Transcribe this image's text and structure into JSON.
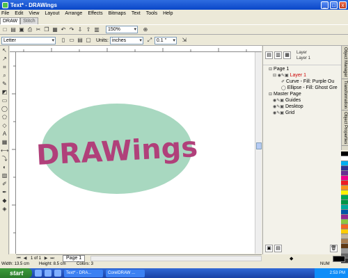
{
  "window": {
    "title": "Text* - DRAWings",
    "controls": [
      "_",
      "□",
      "x"
    ]
  },
  "menu": [
    "File",
    "Edit",
    "View",
    "Layout",
    "Arrange",
    "Effects",
    "Bitmaps",
    "Text",
    "Tools",
    "Help"
  ],
  "mdi_tabs": [
    "DRAW",
    "Stitch"
  ],
  "standard_toolbar": {
    "zoom_value": "150%"
  },
  "property_bar": {
    "paper_size": "Letter",
    "units_label": "Units:",
    "units_value": "inches",
    "nudge_value": "0.1 \""
  },
  "canvas": {
    "ellipse_fill": "#a8d8c0",
    "text": "DRAWings",
    "text_color": "#b0407a"
  },
  "page_nav": {
    "page_tab": "Page 1",
    "page_count": "1 of 1"
  },
  "docker": {
    "header_top": "Layer",
    "header_bottom": "Layer 1",
    "tree": [
      {
        "label": "Page 1",
        "color": "#000"
      },
      {
        "label": "Layer 1",
        "color": "#c00"
      },
      {
        "label": "Curve - Fill: Purple  Ou",
        "color": "#000"
      },
      {
        "label": "Ellipse - Fill: Ghost Gre",
        "color": "#000"
      },
      {
        "label": "Master Page",
        "color": "#000"
      },
      {
        "label": "Guides",
        "color": "#000"
      },
      {
        "label": "Desktop",
        "color": "#000"
      },
      {
        "label": "Grid",
        "color": "#000"
      }
    ]
  },
  "side_tabs": [
    "Object Manager",
    "Transformation",
    "Object Properties"
  ],
  "palette": [
    "#000000",
    "#ffffff",
    "#00aeef",
    "#2e3192",
    "#662d91",
    "#ec008c",
    "#ed1c24",
    "#f7941d",
    "#fff200",
    "#00a651",
    "#009444",
    "#00a99d",
    "#0054a6",
    "#92278f",
    "#8dc63f",
    "#f26522",
    "#ffcc00",
    "#c2b59b",
    "#a67c52",
    "#603913",
    "#999999",
    "#666666",
    "#333333"
  ],
  "status": {
    "width": "Width: 13.5 cm",
    "height": "Height: 8.5 cm",
    "colors": "Colors: 3",
    "mode": "NUM"
  },
  "taskbar": {
    "start": "start",
    "tasks": [
      "Text* - DRA...",
      "CorelDRAW ..."
    ],
    "clock": "2:53 PM"
  }
}
